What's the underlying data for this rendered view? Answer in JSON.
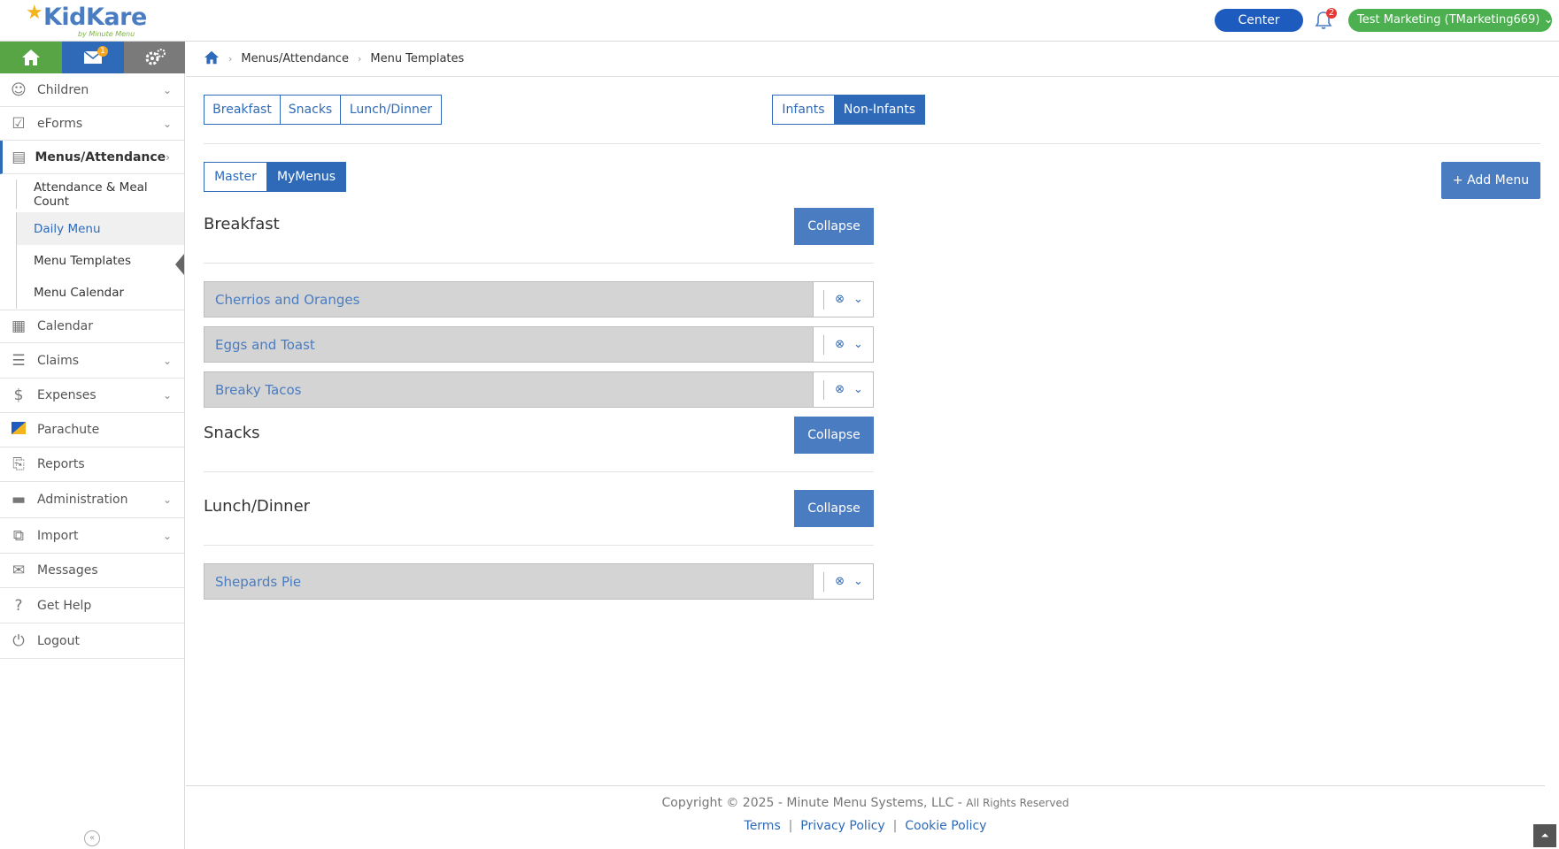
{
  "header": {
    "logo_text": "KidKare",
    "logo_sub": "by Minute Menu",
    "center_label": "Center",
    "notifications_count": "2",
    "user_label": "Test Marketing (TMarketing669)"
  },
  "sidebar": {
    "mail_badge": "1",
    "items": [
      {
        "label": "Children"
      },
      {
        "label": "eForms"
      },
      {
        "label": "Menus/Attendance"
      },
      {
        "label": "Calendar"
      },
      {
        "label": "Claims"
      },
      {
        "label": "Expenses"
      },
      {
        "label": "Parachute"
      },
      {
        "label": "Reports"
      },
      {
        "label": "Administration"
      },
      {
        "label": "Import"
      },
      {
        "label": "Messages"
      },
      {
        "label": "Get Help"
      },
      {
        "label": "Logout"
      }
    ],
    "sub_items": [
      {
        "label": "Attendance & Meal Count"
      },
      {
        "label": "Daily Menu"
      },
      {
        "label": "Menu Templates"
      },
      {
        "label": "Menu Calendar"
      }
    ]
  },
  "breadcrumb": {
    "parent": "Menus/Attendance",
    "current": "Menu Templates"
  },
  "meal_tabs": [
    "Breakfast",
    "Snacks",
    "Lunch/Dinner"
  ],
  "age_tabs": [
    "Infants",
    "Non-Infants"
  ],
  "source_tabs": [
    "Master",
    "MyMenus"
  ],
  "add_menu_label": "+ Add Menu",
  "collapse_label": "Collapse",
  "sections": {
    "breakfast": {
      "title": "Breakfast",
      "menus": [
        "Cherrios and Oranges",
        "Eggs and Toast",
        "Breaky Tacos"
      ]
    },
    "snacks": {
      "title": "Snacks"
    },
    "lunch": {
      "title": "Lunch/Dinner",
      "menus": [
        "Shepards Pie"
      ]
    }
  },
  "footer": {
    "copyright": "Copyright © 2025 - Minute Menu Systems, LLC -",
    "rights": "All Rights Reserved",
    "terms": "Terms",
    "privacy": "Privacy Policy",
    "cookie": "Cookie Policy"
  },
  "colors": {
    "primary": "#2e6ab8",
    "button": "#4a7cc2",
    "green": "#57a545"
  }
}
